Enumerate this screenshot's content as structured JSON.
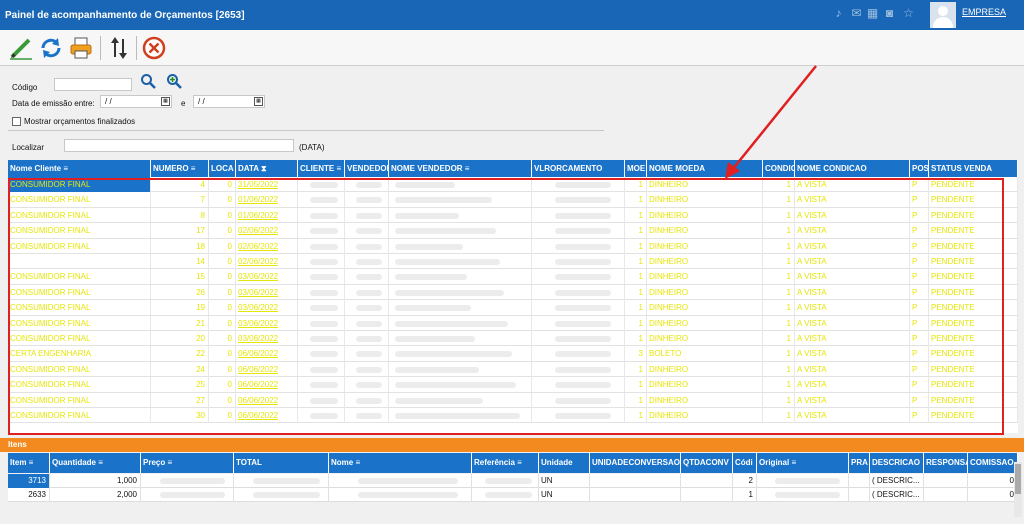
{
  "window": {
    "title": "Painel de acompanhamento de Orçamentos [2653]",
    "company": "EMPRESA"
  },
  "titlebar_icons": [
    "bell-icon",
    "chat-icon",
    "calendar-icon",
    "camera-icon",
    "star-icon"
  ],
  "toolbar": {
    "buttons": [
      {
        "name": "edit-button",
        "icon": "pencil-icon"
      },
      {
        "name": "refresh-button",
        "icon": "refresh-icon"
      },
      {
        "name": "print-button",
        "icon": "printer-icon"
      },
      {
        "name": "sort-button",
        "icon": "sort-icon"
      },
      {
        "name": "cancel-button",
        "icon": "cancel-icon"
      }
    ]
  },
  "filters": {
    "codigo_label": "Código",
    "data_label": "Data de emissão entre:",
    "date_from": " / /",
    "date_sep": "e",
    "date_to": " / /",
    "show_finished_label": "Mostrar orçamentos finalizados",
    "localizar_label": "Localizar",
    "localizar_hint": "(DATA)"
  },
  "grid": {
    "columns": [
      "Nome Cliente ≡",
      "NUMERO ≡",
      "LOCA",
      "DATA ⧗",
      "CLIENTE ≡",
      "VENDEDOR",
      "NOME VENDEDOR ≡",
      "VLRORCAMENTO",
      "MOE",
      "NOME MOEDA",
      "CONDIC",
      "NOME CONDICAO",
      "POS",
      "STATUS VENDA"
    ],
    "rows": [
      {
        "cliente": "CONSUMIDOR FINAL",
        "numero": "4",
        "loca": "0",
        "data": "31/05/2022",
        "moe": "1",
        "moeda": "DINHEIRO",
        "cond": "1",
        "nome_cond": "A VISTA",
        "pos": "P",
        "status": "PENDENTE"
      },
      {
        "cliente": "CONSUMIDOR FINAL",
        "numero": "7",
        "loca": "0",
        "data": "01/06/2022",
        "moe": "1",
        "moeda": "DINHEIRO",
        "cond": "1",
        "nome_cond": "A VISTA",
        "pos": "P",
        "status": "PENDENTE"
      },
      {
        "cliente": "CONSUMIDOR FINAL",
        "numero": "8",
        "loca": "0",
        "data": "01/06/2022",
        "moe": "1",
        "moeda": "DINHEIRO",
        "cond": "1",
        "nome_cond": "A VISTA",
        "pos": "P",
        "status": "PENDENTE"
      },
      {
        "cliente": "CONSUMIDOR FINAL",
        "numero": "17",
        "loca": "0",
        "data": "02/06/2022",
        "moe": "1",
        "moeda": "DINHEIRO",
        "cond": "1",
        "nome_cond": "A VISTA",
        "pos": "P",
        "status": "PENDENTE"
      },
      {
        "cliente": "CONSUMIDOR FINAL",
        "numero": "18",
        "loca": "0",
        "data": "02/06/2022",
        "moe": "1",
        "moeda": "DINHEIRO",
        "cond": "1",
        "nome_cond": "A VISTA",
        "pos": "P",
        "status": "PENDENTE"
      },
      {
        "cliente": "",
        "numero": "14",
        "loca": "0",
        "data": "02/06/2022",
        "moe": "1",
        "moeda": "DINHEIRO",
        "cond": "1",
        "nome_cond": "A VISTA",
        "pos": "P",
        "status": "PENDENTE"
      },
      {
        "cliente": "CONSUMIDOR FINAL",
        "numero": "15",
        "loca": "0",
        "data": "03/06/2022",
        "moe": "1",
        "moeda": "DINHEIRO",
        "cond": "1",
        "nome_cond": "A VISTA",
        "pos": "P",
        "status": "PENDENTE"
      },
      {
        "cliente": "CONSUMIDOR FINAL",
        "numero": "26",
        "loca": "0",
        "data": "03/06/2022",
        "moe": "1",
        "moeda": "DINHEIRO",
        "cond": "1",
        "nome_cond": "A VISTA",
        "pos": "P",
        "status": "PENDENTE"
      },
      {
        "cliente": "CONSUMIDOR FINAL",
        "numero": "19",
        "loca": "0",
        "data": "03/06/2022",
        "moe": "1",
        "moeda": "DINHEIRO",
        "cond": "1",
        "nome_cond": "A VISTA",
        "pos": "P",
        "status": "PENDENTE"
      },
      {
        "cliente": "CONSUMIDOR FINAL",
        "numero": "21",
        "loca": "0",
        "data": "03/06/2022",
        "moe": "1",
        "moeda": "DINHEIRO",
        "cond": "1",
        "nome_cond": "A VISTA",
        "pos": "P",
        "status": "PENDENTE"
      },
      {
        "cliente": "CONSUMIDOR FINAL",
        "numero": "20",
        "loca": "0",
        "data": "03/06/2022",
        "moe": "1",
        "moeda": "DINHEIRO",
        "cond": "1",
        "nome_cond": "A VISTA",
        "pos": "P",
        "status": "PENDENTE"
      },
      {
        "cliente": "CERTA ENGENHARIA",
        "numero": "22",
        "loca": "0",
        "data": "06/06/2022",
        "moe": "3",
        "moeda": "BOLETO",
        "cond": "1",
        "nome_cond": "A VISTA",
        "pos": "P",
        "status": "PENDENTE"
      },
      {
        "cliente": "CONSUMIDOR FINAL",
        "numero": "24",
        "loca": "0",
        "data": "06/06/2022",
        "moe": "1",
        "moeda": "DINHEIRO",
        "cond": "1",
        "nome_cond": "A VISTA",
        "pos": "P",
        "status": "PENDENTE"
      },
      {
        "cliente": "CONSUMIDOR FINAL",
        "numero": "25",
        "loca": "0",
        "data": "06/06/2022",
        "moe": "1",
        "moeda": "DINHEIRO",
        "cond": "1",
        "nome_cond": "A VISTA",
        "pos": "P",
        "status": "PENDENTE"
      },
      {
        "cliente": "CONSUMIDOR FINAL",
        "numero": "27",
        "loca": "0",
        "data": "06/06/2022",
        "moe": "1",
        "moeda": "DINHEIRO",
        "cond": "1",
        "nome_cond": "A VISTA",
        "pos": "P",
        "status": "PENDENTE"
      },
      {
        "cliente": "CONSUMIDOR FINAL",
        "numero": "30",
        "loca": "0",
        "data": "06/06/2022",
        "moe": "1",
        "moeda": "DINHEIRO",
        "cond": "1",
        "nome_cond": "A VISTA",
        "pos": "P",
        "status": "PENDENTE"
      }
    ]
  },
  "items": {
    "title": "Itens",
    "columns": [
      "Item ≡",
      "Quantidade ≡",
      "Preço ≡",
      "TOTAL",
      "Nome ≡",
      "Referência ≡",
      "Unidade",
      "UNIDADECONVERSAO",
      "QTDACONV",
      "Códi",
      "Original ≡",
      "PRA",
      "DESCRICAO",
      "RESPONSÁ",
      "COMISSAO"
    ],
    "rows": [
      {
        "item": "3713",
        "qtd": "1,000",
        "unidade": "UN",
        "codi": "2",
        "descricao": "( DESCRIC...",
        "comissao": "0"
      },
      {
        "item": "2633",
        "qtd": "2,000",
        "unidade": "UN",
        "codi": "1",
        "descricao": "( DESCRIC...",
        "comissao": "0"
      }
    ]
  },
  "colors": {
    "titlebar": "#1866b5",
    "header": "#1a73c9",
    "accent": "#f28a1f",
    "highlight": "#e02020",
    "row_text": "#e6e60a"
  }
}
